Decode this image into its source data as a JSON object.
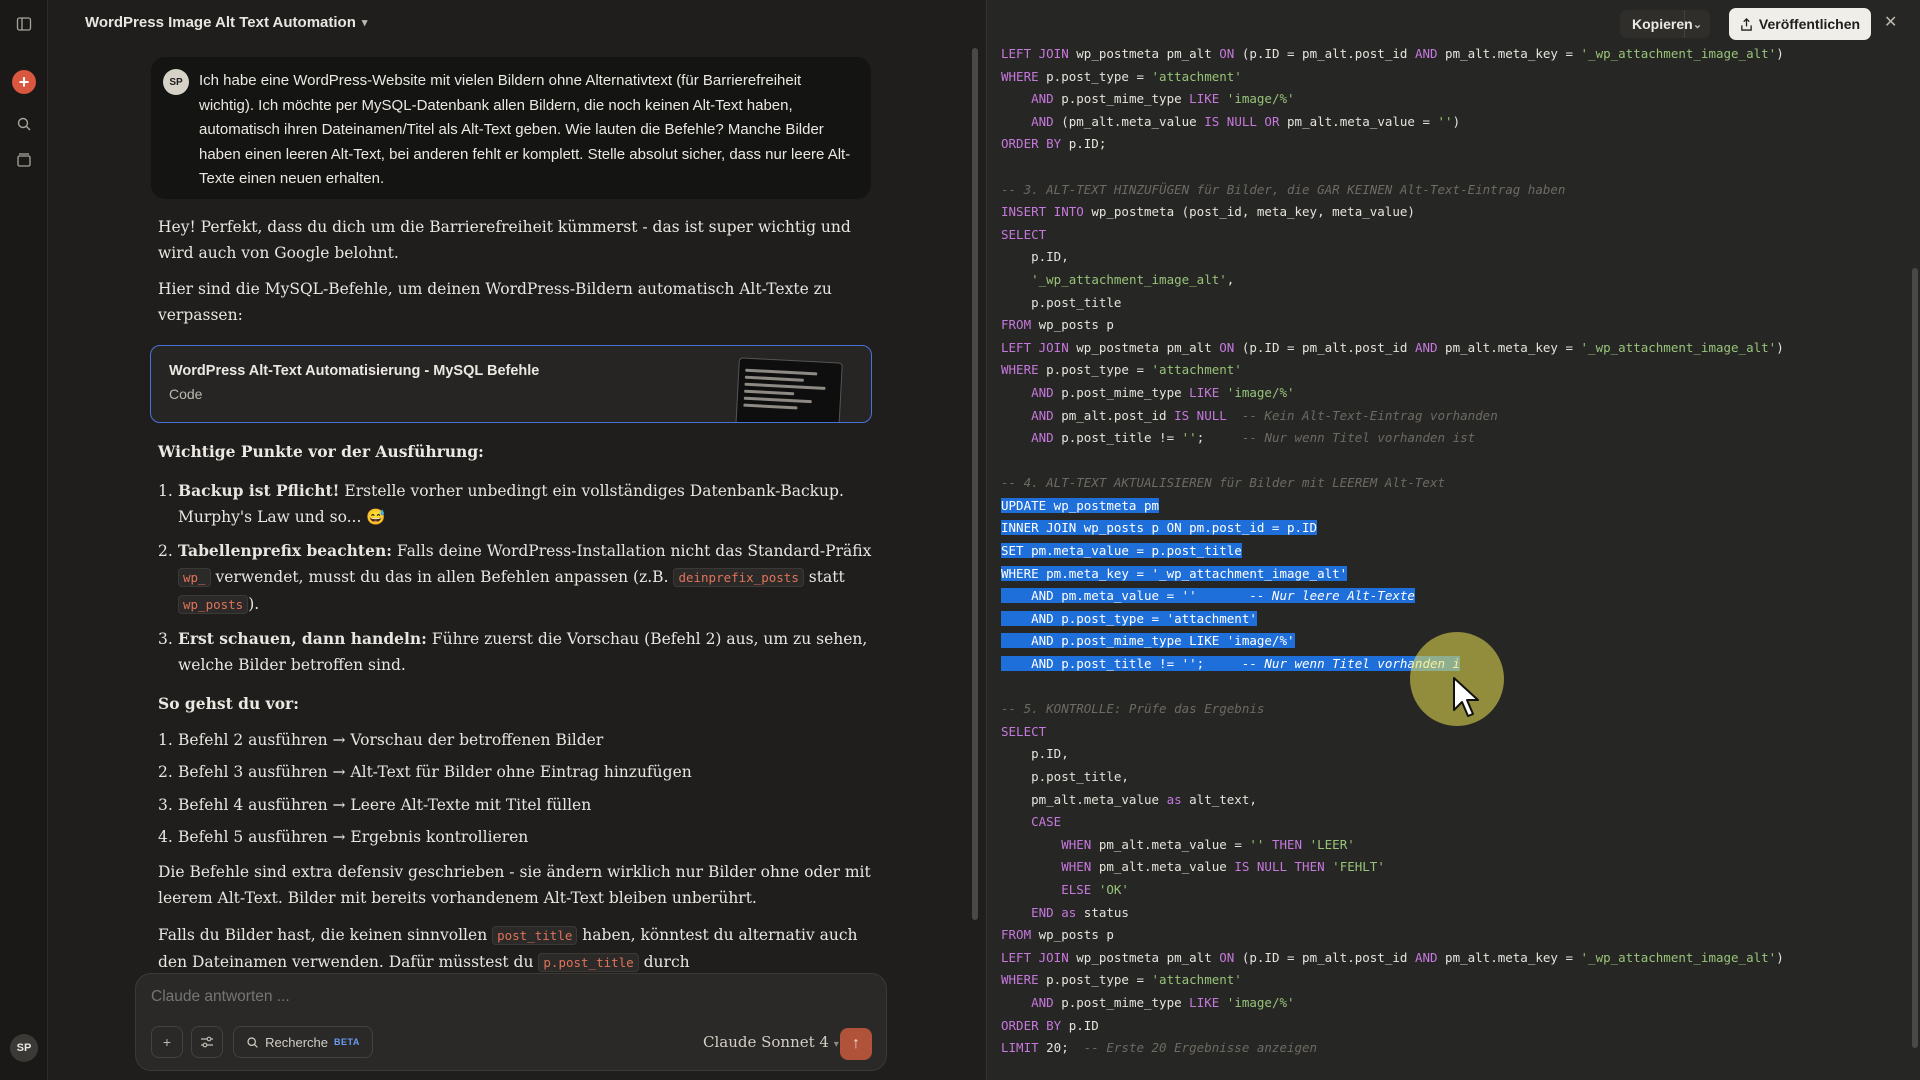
{
  "rail": {
    "avatar": "SP"
  },
  "chat": {
    "title": "WordPress Image Alt Text Automation",
    "user_avatar": "SP",
    "user_message": "Ich habe eine WordPress-Website mit vielen Bildern ohne Alternativtext (für Barrierefreiheit wichtig). Ich möchte per MySQL-Datenbank allen Bildern, die noch keinen Alt-Text haben, automatisch ihren Dateinamen/Titel als Alt-Text geben. Wie lauten die Befehle? Manche Bilder haben einen leeren Alt-Text, bei anderen fehlt er komplett. Stelle absolut sicher, dass nur leere Alt-Texte einen neuen erhalten.",
    "intro": "Hey! Perfekt, dass du dich um die Barrierefreiheit kümmerst - das ist super wichtig und wird auch von Google belohnt.",
    "intro2": "Hier sind die MySQL-Befehle, um deinen WordPress-Bildern automatisch Alt-Texte zu verpassen:",
    "artifact": {
      "title": "WordPress Alt-Text Automatisierung - MySQL Befehle",
      "subtitle": "Code"
    },
    "important_heading": "Wichtige Punkte vor der Ausführung:",
    "points": [
      {
        "num": "1.",
        "bold": "Backup ist Pflicht!",
        "text": " Erstelle vorher unbedingt ein vollständiges Datenbank-Backup. Murphy's Law und so... 😅"
      },
      {
        "num": "2.",
        "bold": "Tabellenprefix beachten:",
        "text1": " Falls deine WordPress-Installation nicht das Standard-Präfix ",
        "code1": "wp_",
        "text2": " verwendet, musst du das in allen Befehlen anpassen (z.B. ",
        "code2": "deinprefix_posts",
        "text3": " statt ",
        "code3": "wp_posts",
        "text4": ")."
      },
      {
        "num": "3.",
        "bold": "Erst schauen, dann handeln:",
        "text": " Führe zuerst die Vorschau (Befehl 2) aus, um zu sehen, welche Bilder betroffen sind."
      }
    ],
    "howto_heading": "So gehst du vor:",
    "steps": [
      {
        "num": "1.",
        "text": "Befehl 2 ausführen → Vorschau der betroffenen Bilder"
      },
      {
        "num": "2.",
        "text": "Befehl 3 ausführen → Alt-Text für Bilder ohne Eintrag hinzufügen"
      },
      {
        "num": "3.",
        "text": "Befehl 4 ausführen → Leere Alt-Texte mit Titel füllen"
      },
      {
        "num": "4.",
        "text": "Befehl 5 ausführen → Ergebnis kontrollieren"
      }
    ],
    "defensive": "Die Befehle sind extra defensiv geschrieben - sie ändern wirklich nur Bilder ohne oder mit leerem Alt-Text. Bilder mit bereits vorhandenem Alt-Text bleiben unberührt.",
    "final": {
      "t1": "Falls du Bilder hast, die keinen sinnvollen ",
      "c1": "post_title",
      "t2": " haben, könntest du alternativ auch den Dateinamen verwenden. Dafür müsstest du ",
      "c2": "p.post_title",
      "t3": " durch"
    }
  },
  "composer": {
    "placeholder": "Claude antworten ...",
    "research_label": "Recherche",
    "beta_label": "BETA",
    "model": "Claude Sonnet 4"
  },
  "code_pane": {
    "copy_label": "Kopieren",
    "publish_label": "Veröffentlichen"
  },
  "colors": {
    "accent": "#d9573f",
    "selection": "#1f6fdb",
    "keyword": "#c678dd",
    "string": "#98c379"
  },
  "code_lines": [
    [
      [
        "kw",
        "LEFT JOIN"
      ],
      [
        "",
        "wp_postmeta pm_alt "
      ],
      [
        "kw",
        "ON"
      ],
      [
        "",
        "(p.ID = pm_alt.post_id "
      ],
      [
        "kw",
        "AND"
      ],
      [
        "",
        "pm_alt.meta_key = "
      ],
      [
        "str",
        "'_wp_attachment_image_alt'"
      ],
      [
        "",
        ")"
      ]
    ],
    [
      [
        "kw",
        "WHERE"
      ],
      [
        "",
        "p.post_type = "
      ],
      [
        "str",
        "'attachment'"
      ]
    ],
    [
      [
        "",
        "    "
      ],
      [
        "kw",
        "AND"
      ],
      [
        "",
        "p.post_mime_type "
      ],
      [
        "kw",
        "LIKE"
      ],
      [
        "str",
        "'image/%'"
      ]
    ],
    [
      [
        "",
        "    "
      ],
      [
        "kw",
        "AND"
      ],
      [
        "",
        "(pm_alt.meta_value "
      ],
      [
        "kw",
        "IS NULL OR"
      ],
      [
        "",
        "pm_alt.meta_value = "
      ],
      [
        "str",
        "''"
      ],
      [
        "",
        ")"
      ]
    ],
    [
      [
        "kw",
        "ORDER BY"
      ],
      [
        "",
        "p.ID;"
      ]
    ],
    [],
    [
      [
        "cm",
        "-- 3. ALT-TEXT HINZUFÜGEN für Bilder, die GAR KEINEN Alt-Text-Eintrag haben"
      ]
    ],
    [
      [
        "kw",
        "INSERT INTO"
      ],
      [
        "",
        "wp_postmeta (post_id, meta_key, meta_value)"
      ]
    ],
    [
      [
        "kw",
        "SELECT"
      ]
    ],
    [
      [
        "",
        "    p.ID,"
      ]
    ],
    [
      [
        "",
        "    "
      ],
      [
        "str",
        "'_wp_attachment_image_alt'"
      ],
      [
        "",
        ","
      ]
    ],
    [
      [
        "",
        "    p.post_title"
      ]
    ],
    [
      [
        "kw",
        "FROM"
      ],
      [
        "",
        "wp_posts p"
      ]
    ],
    [
      [
        "kw",
        "LEFT JOIN"
      ],
      [
        "",
        "wp_postmeta pm_alt "
      ],
      [
        "kw",
        "ON"
      ],
      [
        "",
        "(p.ID = pm_alt.post_id "
      ],
      [
        "kw",
        "AND"
      ],
      [
        "",
        "pm_alt.meta_key = "
      ],
      [
        "str",
        "'_wp_attachment_image_alt'"
      ],
      [
        "",
        ")"
      ]
    ],
    [
      [
        "kw",
        "WHERE"
      ],
      [
        "",
        "p.post_type = "
      ],
      [
        "str",
        "'attachment'"
      ]
    ],
    [
      [
        "",
        "    "
      ],
      [
        "kw",
        "AND"
      ],
      [
        "",
        "p.post_mime_type "
      ],
      [
        "kw",
        "LIKE"
      ],
      [
        "str",
        "'image/%'"
      ]
    ],
    [
      [
        "",
        "    "
      ],
      [
        "kw",
        "AND"
      ],
      [
        "",
        "pm_alt.post_id "
      ],
      [
        "kw",
        "IS NULL"
      ],
      [
        "cm",
        "  -- Kein Alt-Text-Eintrag vorhanden"
      ]
    ],
    [
      [
        "",
        "    "
      ],
      [
        "kw",
        "AND"
      ],
      [
        "",
        "p.post_title != "
      ],
      [
        "str",
        "''"
      ],
      [
        "",
        ";"
      ],
      [
        "cm",
        "     -- Nur wenn Titel vorhanden ist"
      ]
    ],
    [],
    [
      [
        "cm",
        "-- 4. ALT-TEXT AKTUALISIEREN für Bilder mit LEEREM Alt-Text"
      ]
    ],
    [
      [
        "hl",
        "UPDATE wp_postmeta pm"
      ]
    ],
    [
      [
        "hl",
        "INNER JOIN wp_posts p ON pm.post_id = p.ID"
      ]
    ],
    [
      [
        "hl",
        "SET pm.meta_value = p.post_title"
      ]
    ],
    [
      [
        "hl",
        "WHERE pm.meta_key = '_wp_attachment_image_alt'"
      ]
    ],
    [
      [
        "hl",
        "    AND pm.meta_value = ''       "
      ],
      [
        "hlcm",
        "-- Nur leere Alt-Texte"
      ]
    ],
    [
      [
        "hl",
        "    AND p.post_type = 'attachment'"
      ]
    ],
    [
      [
        "hl",
        "    AND p.post_mime_type LIKE 'image/%'"
      ]
    ],
    [
      [
        "hl",
        "    AND p.post_title != '';     "
      ],
      [
        "hlcm",
        "-- Nur wenn Titel vorhanden i"
      ]
    ],
    [],
    [
      [
        "cm",
        "-- 5. KONTROLLE: Prüfe das Ergebnis"
      ]
    ],
    [
      [
        "kw",
        "SELECT"
      ]
    ],
    [
      [
        "",
        "    p.ID,"
      ]
    ],
    [
      [
        "",
        "    p.post_title,"
      ]
    ],
    [
      [
        "",
        "    pm_alt.meta_value "
      ],
      [
        "kw",
        "as"
      ],
      [
        "",
        "alt_text,"
      ]
    ],
    [
      [
        "",
        "    "
      ],
      [
        "kw",
        "CASE"
      ]
    ],
    [
      [
        "",
        "        "
      ],
      [
        "kw",
        "WHEN"
      ],
      [
        "",
        "pm_alt.meta_value = "
      ],
      [
        "str",
        "''"
      ],
      [
        "kw",
        "THEN"
      ],
      [
        "str",
        "'LEER'"
      ]
    ],
    [
      [
        "",
        "        "
      ],
      [
        "kw",
        "WHEN"
      ],
      [
        "",
        "pm_alt.meta_value "
      ],
      [
        "kw",
        "IS NULL THEN"
      ],
      [
        "str",
        "'FEHLT'"
      ]
    ],
    [
      [
        "",
        "        "
      ],
      [
        "kw",
        "ELSE"
      ],
      [
        "str",
        "'OK'"
      ]
    ],
    [
      [
        "",
        "    "
      ],
      [
        "kw",
        "END as"
      ],
      [
        "",
        "status"
      ]
    ],
    [
      [
        "kw",
        "FROM"
      ],
      [
        "",
        "wp_posts p"
      ]
    ],
    [
      [
        "kw",
        "LEFT JOIN"
      ],
      [
        "",
        "wp_postmeta pm_alt "
      ],
      [
        "kw",
        "ON"
      ],
      [
        "",
        "(p.ID = pm_alt.post_id "
      ],
      [
        "kw",
        "AND"
      ],
      [
        "",
        "pm_alt.meta_key = "
      ],
      [
        "str",
        "'_wp_attachment_image_alt'"
      ],
      [
        "",
        ")"
      ]
    ],
    [
      [
        "kw",
        "WHERE"
      ],
      [
        "",
        "p.post_type = "
      ],
      [
        "str",
        "'attachment'"
      ]
    ],
    [
      [
        "",
        "    "
      ],
      [
        "kw",
        "AND"
      ],
      [
        "",
        "p.post_mime_type "
      ],
      [
        "kw",
        "LIKE"
      ],
      [
        "str",
        "'image/%'"
      ]
    ],
    [
      [
        "kw",
        "ORDER BY"
      ],
      [
        "",
        "p.ID"
      ]
    ],
    [
      [
        "kw",
        "LIMIT"
      ],
      [
        "",
        "20;"
      ],
      [
        "cm",
        "  -- Erste 20 Ergebnisse anzeigen"
      ]
    ]
  ]
}
